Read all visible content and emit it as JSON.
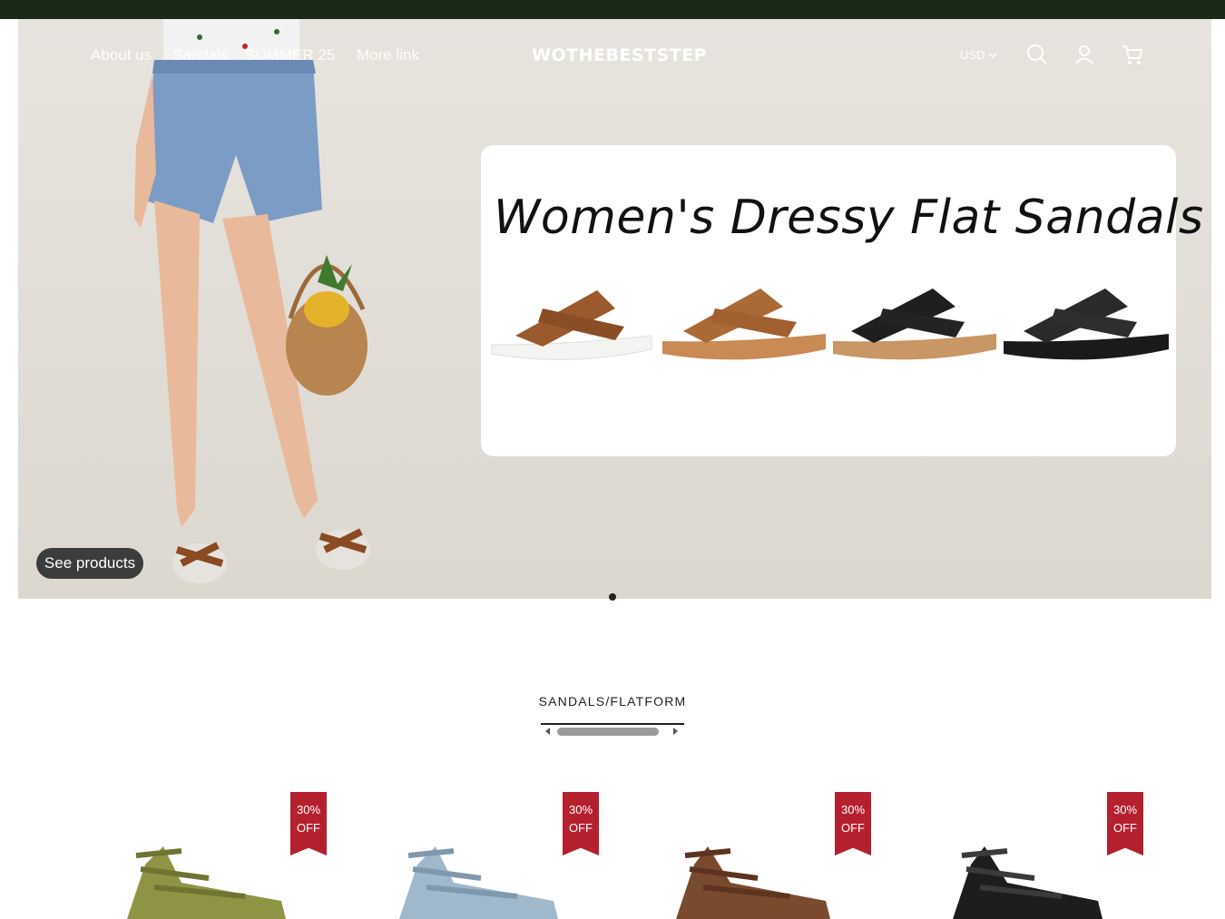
{
  "nav": {
    "links": [
      "About us",
      "Sandals",
      "SUMMER 25",
      "More link"
    ],
    "logo": "WOTHEBESTSTEP",
    "currency": "USD"
  },
  "hero": {
    "promo_title": "Women's Dressy Flat Sandals",
    "cta_label": "See products",
    "slide_count": 1
  },
  "section": {
    "title": "SANDALS/FLATFORM"
  },
  "products": [
    {
      "badge_line1": "30%",
      "badge_line2": "OFF",
      "color": "#8f9445"
    },
    {
      "badge_line1": "30%",
      "badge_line2": "OFF",
      "color": "#9fb8cc"
    },
    {
      "badge_line1": "30%",
      "badge_line2": "OFF",
      "color": "#7a4a2e"
    },
    {
      "badge_line1": "30%",
      "badge_line2": "OFF",
      "color": "#1d1d1d"
    }
  ],
  "colors": {
    "topbar": "#1b2a18",
    "badge": "#b5202f"
  }
}
